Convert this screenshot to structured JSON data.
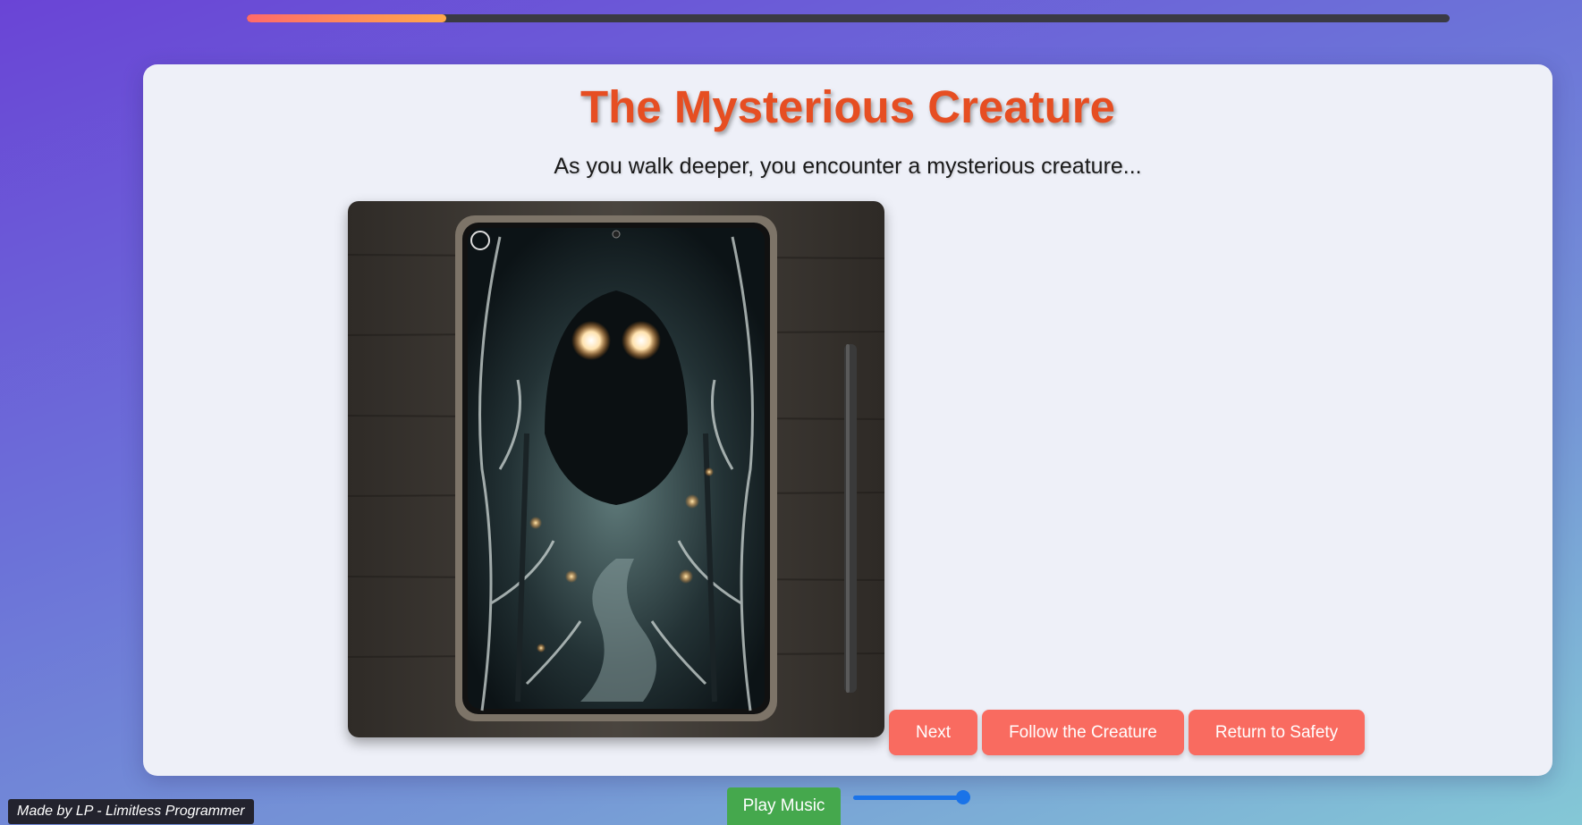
{
  "progress": {
    "fraction": 0.166
  },
  "story": {
    "title": "The Mysterious Creature",
    "text": "As you walk deeper, you encounter a mysterious creature...",
    "title_color": "#e64e22"
  },
  "choices": [
    {
      "label": "Next"
    },
    {
      "label": "Follow the Creature"
    },
    {
      "label": "Return to Safety"
    }
  ],
  "controls": {
    "play_label": "Play Music",
    "volume": 1.0
  },
  "credit": "Made by LP - Limitless Programmer",
  "colors": {
    "accent": "#f96b60",
    "play": "#45a84d",
    "slider": "#1a73e8"
  }
}
